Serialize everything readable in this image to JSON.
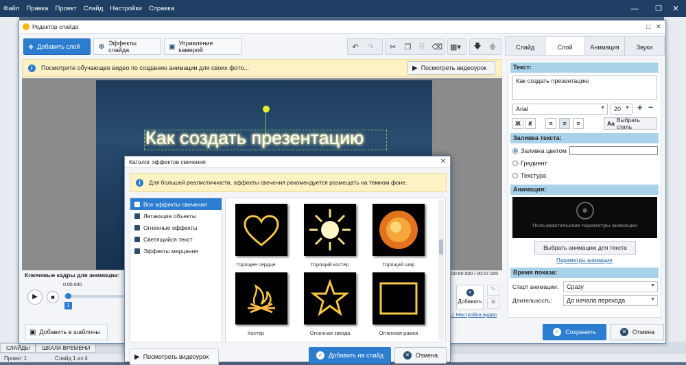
{
  "menubar": {
    "items": [
      "Файл",
      "Правка",
      "Проект",
      "Слайд",
      "Настройки",
      "Справка"
    ]
  },
  "editor": {
    "title": "Редактор слайда",
    "toolbar": {
      "add_layer": "Добавить слой",
      "slide_effects": "Эффекты слайда",
      "camera": "Управление камерой"
    },
    "info": {
      "text": "Посмотрите обучающее видео по созданию анимации для своих фото...",
      "watch_button": "Посмотреть видеоурок"
    },
    "slide_text": "Как создать презентацию",
    "keyframes": {
      "label": "Ключевые кадры для анимации:",
      "start_time": "0:00.000",
      "time_range": "00:00.000 / 00:07.000",
      "marker": "1"
    },
    "audio": {
      "add_label": "Добавить",
      "settings_link": "Настройка аудио"
    },
    "add_to_templates": "Добавить в шаблоны",
    "save": "Сохранить",
    "cancel": "Отмена"
  },
  "right_panel": {
    "tabs": [
      "Слайд",
      "Слой",
      "Анимация",
      "Звуки"
    ],
    "active_tab": "Слой",
    "text_section": "Текст:",
    "text_value": "Как создать презентацию",
    "font": "Arial",
    "font_size": "20",
    "bold": "Ж",
    "italic": "К",
    "choose_style": "Выбрать стиль",
    "fill_section": "Заливка текста:",
    "fill_options": [
      "Заливка цветом",
      "Градиент",
      "Текстура"
    ],
    "animation_section": "Анимация:",
    "custom_anim": "Пользовательские параметры анимации",
    "choose_anim_button": "Выбрать анимацию для текста",
    "anim_params_link": "Параметры анимации",
    "time_section": "Время показа:",
    "start_label": "Старт анимации:",
    "start_value": "Сразу",
    "duration_label": "Длительность:",
    "duration_value": "До начала перехода"
  },
  "glow_dialog": {
    "title": "Каталог эффектов свечения",
    "info": "Для большей реалистичности, эффекты свечения рекомендуется размещать на темном фоне.",
    "categories": [
      "Все эффекты свечения",
      "Летающие объекты",
      "Огненные эффекты",
      "Светящийся текст",
      "Эффекты мерцания"
    ],
    "effects": [
      "Горящее сердце",
      "Горящий костер",
      "Горящий шар",
      "Костер",
      "Огненная звезда",
      "Огненная рамка"
    ],
    "watch_button": "Посмотреть видеоурок",
    "add_button": "Добавить на слайд",
    "cancel_button": "Отмена"
  },
  "bottom": {
    "tabs": [
      "СЛАЙДЫ",
      "ШКАЛА ВРЕМЕНИ"
    ],
    "project": "Проект 1",
    "slide_counter": "Слайд 1 из 4"
  },
  "colors": {
    "accent": "#2c7cd0",
    "menubar": "#1e3f63",
    "section_header": "#a8d2ea",
    "info_bg": "#fdf2c4"
  }
}
